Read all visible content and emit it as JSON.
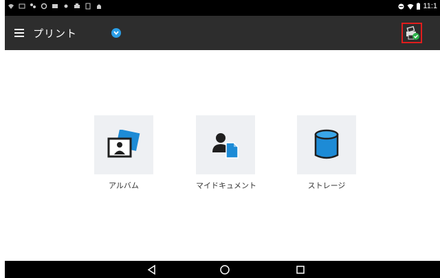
{
  "status_bar": {
    "time": "11:1"
  },
  "app_bar": {
    "title": "プリント"
  },
  "tiles": [
    {
      "label": "アルバム",
      "icon": "album-icon"
    },
    {
      "label": "マイドキュメント",
      "icon": "my-document-icon"
    },
    {
      "label": "ストレージ",
      "icon": "storage-icon"
    }
  ],
  "colors": {
    "app_bar_bg": "#2d2d2d",
    "accent": "#2b9fe8",
    "tile_bg": "#eef0f3",
    "icon_blue": "#1d8bd6",
    "highlight": "#e21d1d"
  }
}
